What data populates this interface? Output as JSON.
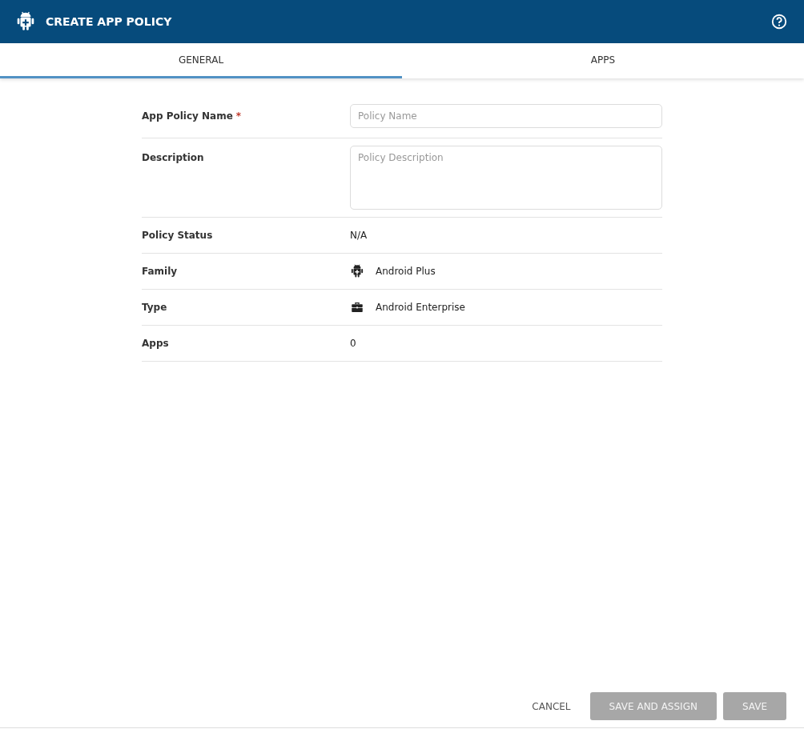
{
  "header": {
    "title": "CREATE APP POLICY"
  },
  "tabs": [
    {
      "label": "GENERAL",
      "selected": true
    },
    {
      "label": "APPS",
      "selected": false
    }
  ],
  "form": {
    "rows": [
      {
        "kind": "input",
        "label": "App Policy Name",
        "required_mark": "*",
        "placeholder": "Policy Name"
      },
      {
        "kind": "textarea",
        "label": "Description",
        "placeholder": "Policy Description"
      },
      {
        "kind": "text",
        "label": "Policy Status",
        "value": "N/A"
      },
      {
        "kind": "android",
        "label": "Family",
        "value": "Android Plus"
      },
      {
        "kind": "briefcase",
        "label": "Type",
        "value": "Android Enterprise"
      },
      {
        "kind": "text",
        "label": "Apps",
        "value": "0"
      }
    ]
  },
  "footer": {
    "buttons": [
      {
        "label": "CANCEL",
        "kind": "flat",
        "disabled": false
      },
      {
        "label": "SAVE AND ASSIGN",
        "kind": "raised",
        "disabled": true
      },
      {
        "label": "SAVE",
        "kind": "raised",
        "disabled": true
      }
    ]
  }
}
